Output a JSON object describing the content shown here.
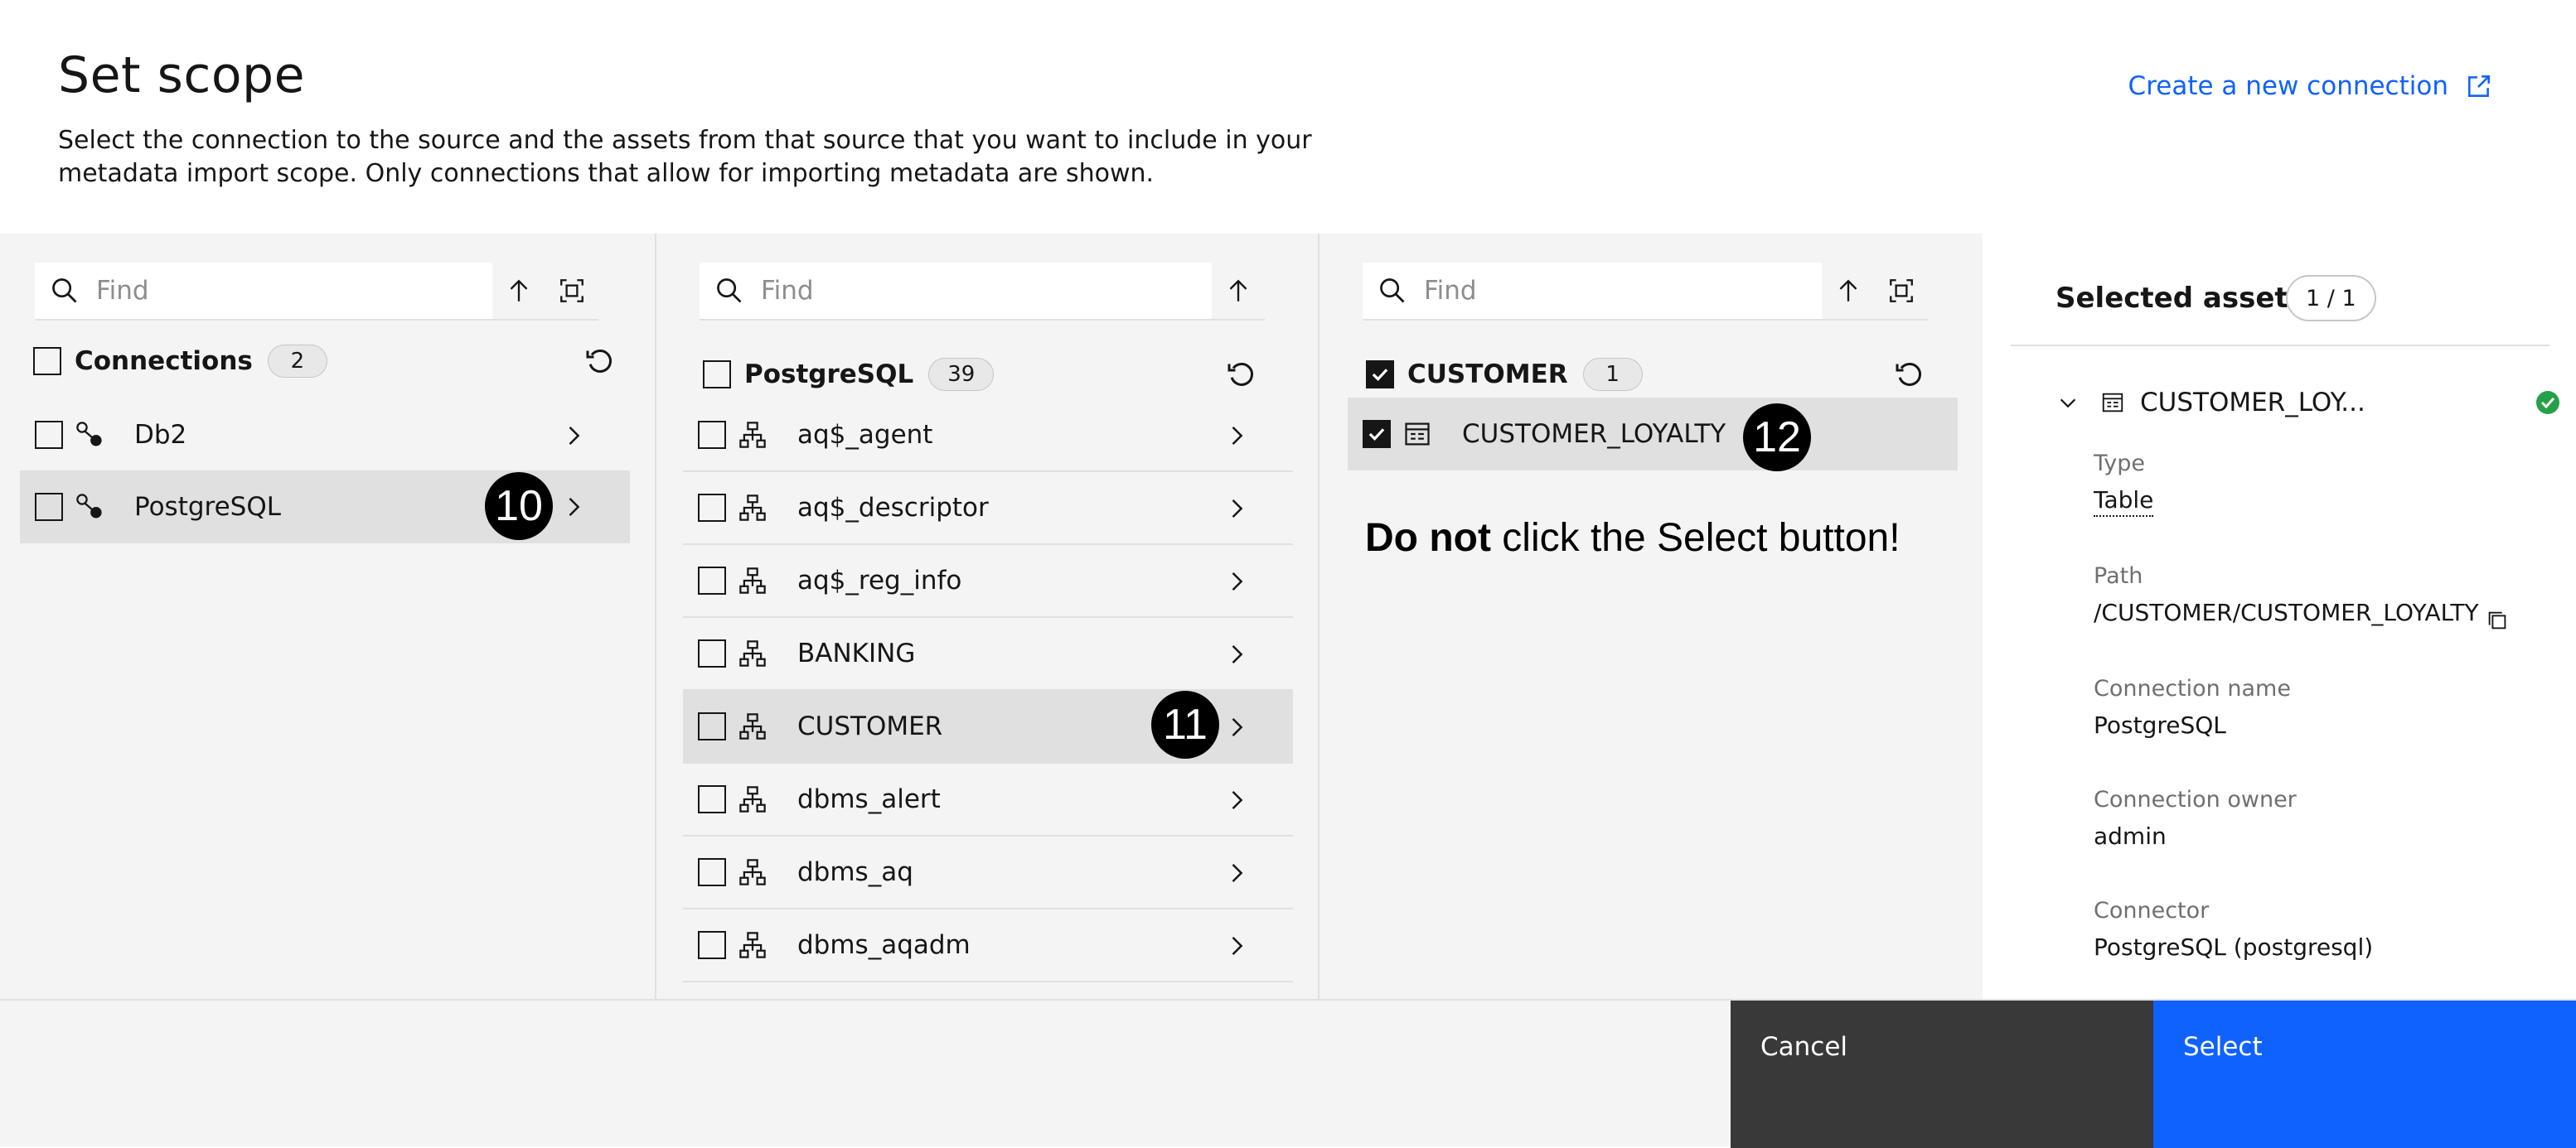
{
  "header": {
    "title": "Set scope",
    "description": "Select the connection to the source and the assets from that source that you want to include in your metadata import scope. Only connections that allow for importing metadata are shown.",
    "create_link": "Create a new connection"
  },
  "col1": {
    "search_placeholder": "Find",
    "heading": "Connections",
    "count": "2",
    "items": [
      {
        "label": "Db2"
      },
      {
        "label": "PostgreSQL"
      }
    ]
  },
  "col2": {
    "search_placeholder": "Find",
    "heading": "PostgreSQL",
    "count": "39",
    "items": [
      {
        "label": "aq$_agent"
      },
      {
        "label": "aq$_descriptor"
      },
      {
        "label": "aq$_reg_info"
      },
      {
        "label": "BANKING"
      },
      {
        "label": "CUSTOMER"
      },
      {
        "label": "dbms_alert"
      },
      {
        "label": "dbms_aq"
      },
      {
        "label": "dbms_aqadm"
      }
    ]
  },
  "col3": {
    "search_placeholder": "Find",
    "heading": "CUSTOMER",
    "count": "1",
    "items": [
      {
        "label": "CUSTOMER_LOYALTY"
      }
    ]
  },
  "markers": {
    "m10": "10",
    "m11": "11",
    "m12": "12"
  },
  "note": {
    "bold": "Do not",
    "rest": " click the Select button!"
  },
  "selected": {
    "title": "Selected assets",
    "count": "1 / 1",
    "asset_name": "CUSTOMER_LOY...",
    "fields": {
      "type_label": "Type",
      "type_value": "Table",
      "path_label": "Path",
      "path_value": "/CUSTOMER/CUSTOMER_LOYALTY",
      "conn_label": "Connection name",
      "conn_value": "PostgreSQL",
      "owner_label": "Connection owner",
      "owner_value": "admin",
      "connector_label": "Connector",
      "connector_value": "PostgreSQL (postgresql)"
    }
  },
  "footer": {
    "cancel": "Cancel",
    "select": "Select"
  },
  "colors": {
    "accent": "#0f62fe",
    "success": "#24a148",
    "dark_button": "#393939"
  }
}
